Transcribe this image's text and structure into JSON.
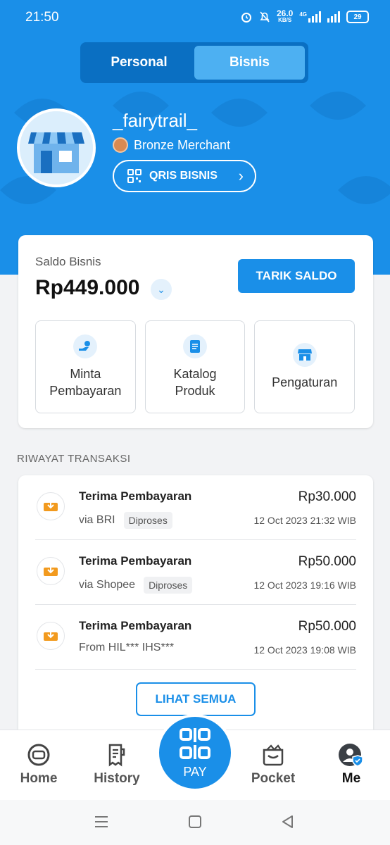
{
  "status_bar": {
    "time": "21:50",
    "speed_value": "26.0",
    "speed_unit": "KB/S",
    "network": "4G",
    "battery": "29"
  },
  "tabs": [
    {
      "label": "Personal",
      "active": false
    },
    {
      "label": "Bisnis",
      "active": true
    }
  ],
  "merchant": {
    "name": "_fairytrail_",
    "tier": "Bronze Merchant",
    "qris_label": "QRIS BISNIS"
  },
  "balance": {
    "label": "Saldo Bisnis",
    "value": "Rp449.000",
    "withdraw_label": "TARIK SALDO"
  },
  "actions": [
    {
      "label": "Minta Pembayaran",
      "icon": "hand-coin-icon"
    },
    {
      "label": "Katalog Produk",
      "icon": "document-icon"
    },
    {
      "label": "Pengaturan",
      "icon": "store-icon"
    }
  ],
  "history": {
    "title": "RIWAYAT TRANSAKSI",
    "see_all_label": "LIHAT SEMUA",
    "items": [
      {
        "title": "Terima Pembayaran",
        "source": "via BRI",
        "status": "Diproses",
        "amount": "Rp30.000",
        "date": "12 Oct 2023 21:32 WIB"
      },
      {
        "title": "Terima Pembayaran",
        "source": "via Shopee",
        "status": "Diproses",
        "amount": "Rp50.000",
        "date": "12 Oct 2023 19:16 WIB"
      },
      {
        "title": "Terima Pembayaran",
        "source": "From HIL*** IHS***",
        "status": "",
        "amount": "Rp50.000",
        "date": "12 Oct 2023 19:08 WIB"
      }
    ]
  },
  "nav": {
    "home": "Home",
    "history": "History",
    "pay": "PAY",
    "pocket": "Pocket",
    "me": "Me"
  },
  "colors": {
    "primary": "#1a8fe8",
    "accent_orange": "#f29a1e"
  }
}
